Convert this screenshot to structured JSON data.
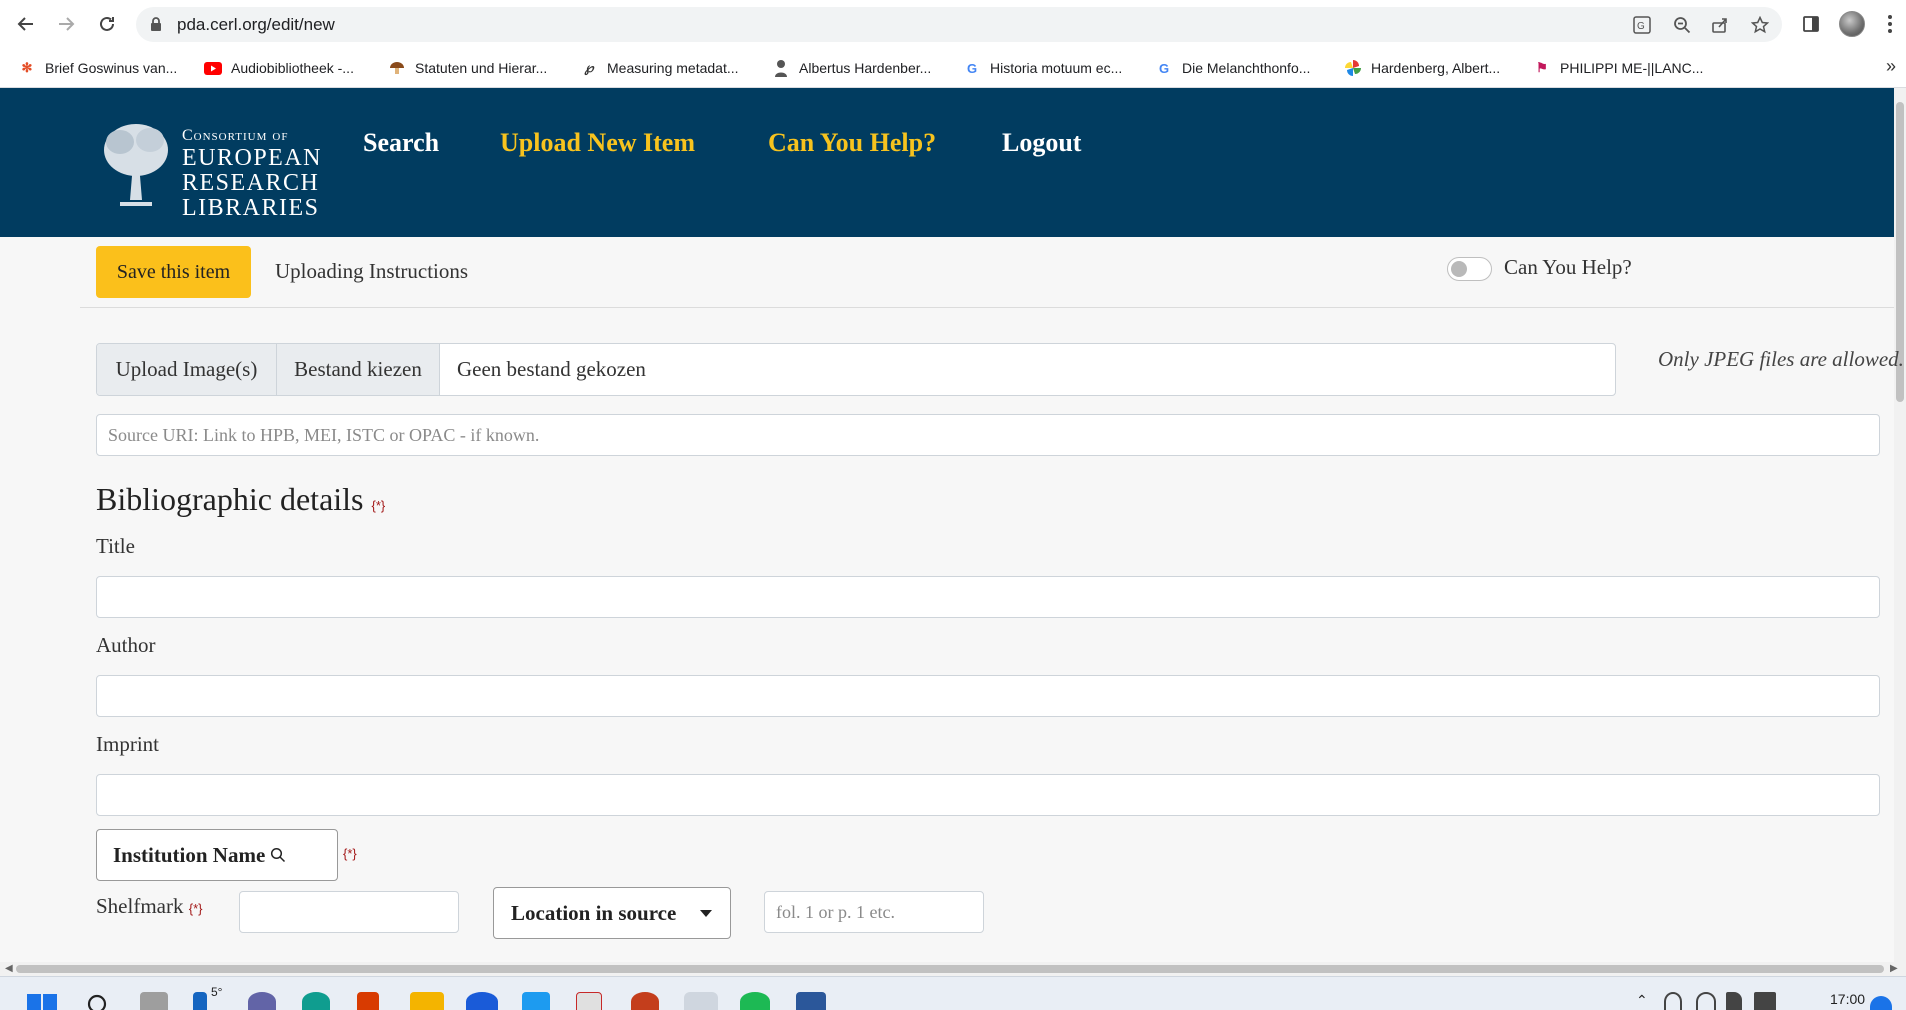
{
  "browser": {
    "url": "pda.cerl.org/edit/new",
    "bookmarks": [
      "Brief Goswinus van...",
      "Audiobibliotheek -...",
      "Statuten und Hierar...",
      "Measuring metadat...",
      "Albertus Hardenber...",
      "Historia motuum ec...",
      "Die Melanchthonfo...",
      "Hardenberg, Albert...",
      "PHILIPPI ME-||LANC..."
    ],
    "bookmarks_overflow": "»"
  },
  "header": {
    "logo": {
      "line1": "Consortium of",
      "line2": "EUROPEAN",
      "line3": "RESEARCH",
      "line4": "LIBRARIES"
    },
    "nav": {
      "search": "Search",
      "upload": "Upload New Item",
      "help": "Can You Help?",
      "logout": "Logout"
    }
  },
  "toolbar": {
    "save_label": "Save this item",
    "instructions_label": "Uploading Instructions",
    "toggle_label": "Can You Help?",
    "toggle_on": false
  },
  "upload": {
    "label": "Upload Image(s)",
    "choose_label": "Bestand kiezen",
    "no_file": "Geen bestand gekozen",
    "note": "Only JPEG files are allowed."
  },
  "source_uri": {
    "placeholder": "Source URI: Link to HPB, MEI, ISTC or OPAC - if known."
  },
  "bibliographic": {
    "title": "Bibliographic details",
    "required_mark": "{*}",
    "fields": {
      "title": "Title",
      "author": "Author",
      "imprint": "Imprint"
    },
    "institution_label": "Institution Name",
    "shelfmark_label": "Shelfmark",
    "location_label": "Location in source",
    "location_placeholder": "fol. 1 or p. 1 etc."
  },
  "taskbar": {
    "temperature": "5°",
    "time": "17:00"
  },
  "colors": {
    "header_bg": "#013c60",
    "accent_gold": "#f7c31e",
    "save_button": "#fbc01b"
  }
}
